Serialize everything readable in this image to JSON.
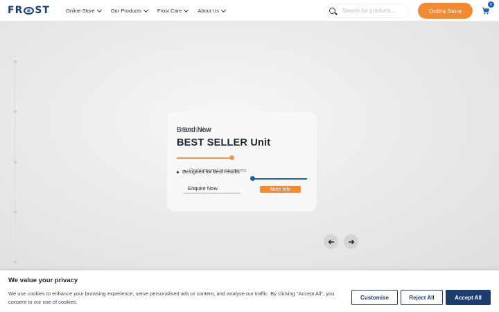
{
  "brand": {
    "logo_text_left": "FR",
    "logo_text_right": "ST"
  },
  "nav": {
    "items": [
      {
        "label": "Online Store"
      },
      {
        "label": "Our Products"
      },
      {
        "label": "Frost Care"
      },
      {
        "label": "About Us"
      }
    ]
  },
  "search": {
    "placeholder": "Search for products..."
  },
  "header": {
    "store_button": "Online Store",
    "cart_count": "0"
  },
  "hero": {
    "eyebrow": "Brand New",
    "eyebrow_overlay": "Exclusive",
    "title": "Unit",
    "title_overlay": "BEST SELLER",
    "bullet": "Designed for best results",
    "bullet_overlay": "Professional Instruments",
    "enquire_label": "Enquire Now",
    "more_label": "More Info",
    "slider_value": 0
  },
  "cookie": {
    "title": "We value your privacy",
    "description": "We use cookies to enhance your browsing experience, serve personalised ads or content, and analyse our traffic. By clicking \"Accept All\", you consent to our use of cookies.",
    "customise": "Customise",
    "reject": "Reject All",
    "accept": "Accept All"
  },
  "colors": {
    "accent": "#f28a33",
    "brand": "#1c3c6e",
    "link": "#1c5fae"
  }
}
